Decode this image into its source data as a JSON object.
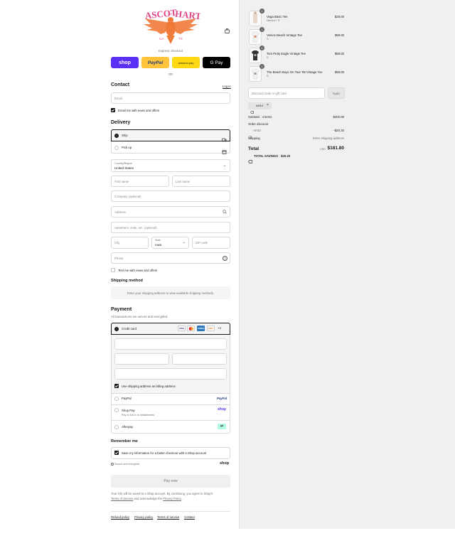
{
  "brand": {
    "name_line1": "ASCOT",
    "name_amp": "and",
    "name_line2": "HART",
    "badge_left": "CA",
    "badge_right": "TX"
  },
  "express": {
    "label": "Express checkout",
    "or": "OR",
    "shop_label": "shop",
    "paypal_label": "PayPal",
    "amazon_label": "amazon pay",
    "gpay_label": "G Pay"
  },
  "contact": {
    "title": "Contact",
    "login": "Log in",
    "email_placeholder": "Email",
    "email_news": "Email me with news and offers"
  },
  "delivery": {
    "title": "Delivery",
    "ship": "Ship",
    "pickup": "Pick up",
    "country_label": "Country/Region",
    "country_value": "United States",
    "first_name": "First name",
    "last_name": "Last name",
    "company": "Company (optional)",
    "address": "Address",
    "apartment": "Apartment, suite, etc. (optional)",
    "city": "City",
    "state_label": "State",
    "state_value": "Iowa",
    "zip": "ZIP code",
    "phone": "Phone",
    "text_news": "Text me with news and offers"
  },
  "shipping_method": {
    "title": "Shipping method",
    "message": "Enter your shipping address to view available shipping methods."
  },
  "payment": {
    "title": "Payment",
    "subtitle": "All transactions are secure and encrypted.",
    "credit_card": "Credit card",
    "card_brands": [
      "VISA",
      "MC",
      "AMEX",
      "DISC"
    ],
    "more_cards": "+4",
    "billing_same": "Use shipping address as billing address",
    "paypal": "PayPal",
    "shop_pay": "Shop Pay",
    "shop_pay_sub": "Pay in full or in installments",
    "afterpay": "Afterpay",
    "paypal_logo": "PayPal",
    "shop_logo": "shop"
  },
  "remember": {
    "title": "Remember me",
    "save_info": "Save my information for a faster checkout with a Shop account",
    "secure": "Secure and encrypted",
    "shop_logo": "shop"
  },
  "pay_button": "Pay now",
  "legal": {
    "text1": "Your info will be saved to a Shop account. By continuing, you agree to Shop's",
    "terms": "Terms of Service",
    "and": "and acknowledge the",
    "privacy": "Privacy Policy",
    "period": "."
  },
  "footer": {
    "refund": "Refund policy",
    "privacy": "Privacy policy",
    "terms": "Terms of service",
    "contact": "Contact"
  },
  "cart": {
    "items": [
      {
        "name": "Vega Basic Tee",
        "variant": "Marsha / S",
        "price": "$28.00",
        "qty": "1"
      },
      {
        "name": "Venice Beach Vintage Tee",
        "variant": "S",
        "price": "$58.00",
        "qty": "1"
      },
      {
        "name": "Tom Petty Eagle Vintage Tee",
        "variant": "S",
        "price": "$58.00",
        "qty": "1"
      },
      {
        "name": "The Beach Boys On Tour '85 Vintage Tee",
        "variant": "S",
        "price": "$58.00",
        "qty": "1"
      }
    ],
    "discount_placeholder": "Discount code or gift card",
    "apply": "Apply",
    "code_tag": "AH10",
    "subtotal_label": "Subtotal · 4 items",
    "subtotal_value": "$202.00",
    "order_discount_label": "Order discount",
    "order_discount_code": "AH10",
    "order_discount_value": "−$20.20",
    "shipping_label": "Shipping",
    "shipping_value": "Enter shipping address",
    "total_label": "Total",
    "currency": "USD",
    "total_value": "$181.80",
    "savings_label": "TOTAL SAVINGS",
    "savings_value": "$20.20"
  },
  "colors": {
    "shop_purple": "#5a31f4",
    "paypal_yellow": "#ffc439",
    "amazon_yellow": "#ffd814",
    "brand_orange": "#f07a3a",
    "brand_pink": "#e0458a"
  }
}
